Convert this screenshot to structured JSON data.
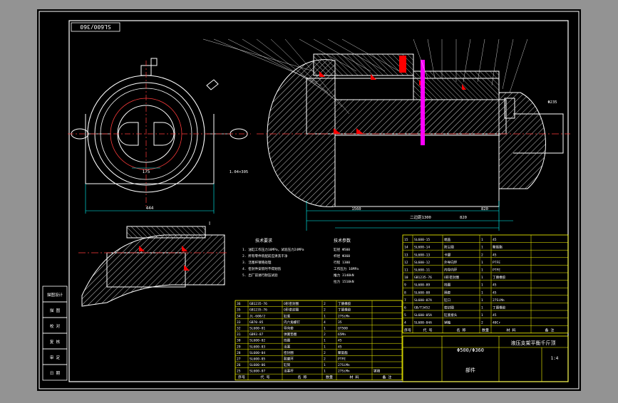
{
  "drawing": {
    "stamp": "SL600/360",
    "title_right": "液压支架平衡千斤顶",
    "title_label": "部件",
    "model_label": "Φ500/Φ360",
    "scale": "1:4",
    "view_callout": "Ⅰ"
  },
  "left_stamp_labels": [
    "描图设计",
    "描 图",
    "校 对",
    "复 核",
    "审 定",
    "日 期"
  ],
  "dimensions": {
    "dim_bottom_left": "444",
    "dim_center_a": "175",
    "dim_bottom_right_a": "1.04×305",
    "dim_long": "二边距1300",
    "dim_overall": "1560",
    "dim_rod": "820",
    "dim_end": "820",
    "dim_side": "Φ235"
  },
  "tech_requirements": {
    "title": "技术要求",
    "lines": [
      "1. 油缸工作压力16MPa，试验压力24MPa",
      "2. 所有零件装配前应清洗干净",
      "3. 活塞杆镀铬处理",
      "4. 密封件安装时不得划伤",
      "5. 出厂前进行耐压试验"
    ]
  },
  "tech_specs": {
    "title": "技术参数",
    "lines": [
      "缸径 Φ500",
      "杆径 Φ360",
      "行程 1300",
      "工作压力 16MPa",
      "推力 3140kN",
      "拉力 1510kN"
    ]
  },
  "parts_left_header": [
    "序号",
    "代 号",
    "名 称",
    "数量",
    "材 料",
    "备 注"
  ],
  "parts_left": [
    [
      "36",
      "GB1235-76",
      "O形密封圈",
      "2",
      "丁腈橡胶",
      ""
    ],
    [
      "35",
      "GB1235-76",
      "O形密封圈",
      "2",
      "丁腈橡胶",
      ""
    ],
    [
      "34",
      "JL-600/2",
      "缸底",
      "1",
      "27SiMn",
      ""
    ],
    [
      "33",
      "GB70-85",
      "内六角螺钉",
      "4",
      "35",
      ""
    ],
    [
      "32",
      "SL600-01",
      "导向套",
      "1",
      "QT500",
      ""
    ],
    [
      "31",
      "GB93-87",
      "弹簧垫圈",
      "2",
      "65Mn",
      ""
    ],
    [
      "30",
      "SL600-02",
      "挡圈",
      "1",
      "45",
      ""
    ],
    [
      "29",
      "SL600-03",
      "活塞",
      "1",
      "45",
      ""
    ],
    [
      "28",
      "SL600-04",
      "密封圈",
      "2",
      "聚氨酯",
      ""
    ],
    [
      "27",
      "SL600-05",
      "耐磨环",
      "2",
      "PTFE",
      ""
    ],
    [
      "26",
      "SL600-06",
      "缸筒",
      "1",
      "27SiMn",
      ""
    ],
    [
      "25",
      "SL600-07",
      "活塞杆",
      "1",
      "27SiMn",
      "镀铬"
    ]
  ],
  "parts_right": [
    [
      "15",
      "SL600-15",
      "端盖",
      "1",
      "45",
      ""
    ],
    [
      "14",
      "SL600-14",
      "防尘圈",
      "1",
      "聚氨酯",
      ""
    ],
    [
      "13",
      "SL600-13",
      "卡键",
      "2",
      "45",
      ""
    ],
    [
      "12",
      "SL600-12",
      "外导向环",
      "1",
      "PTFE",
      ""
    ],
    [
      "11",
      "SL600-11",
      "内导向环",
      "1",
      "PTFE",
      ""
    ],
    [
      "10",
      "GB1235-76",
      "O形密封圈",
      "1",
      "丁腈橡胶",
      ""
    ],
    [
      "9",
      "SL600-09",
      "挡圈",
      "1",
      "45",
      ""
    ],
    [
      "8",
      "SL600-08",
      "隔套",
      "1",
      "45",
      ""
    ],
    [
      "7",
      "SL600-07A",
      "缸口",
      "1",
      "27SiMn",
      ""
    ],
    [
      "6",
      "GB/T3452",
      "密封圈",
      "1",
      "丁腈橡胶",
      ""
    ],
    [
      "5",
      "SL600-05A",
      "缸底接头",
      "1",
      "45",
      ""
    ],
    [
      "4",
      "SL600-04A",
      "销轴",
      "2",
      "40Cr",
      ""
    ]
  ],
  "parts_right_header": [
    "序号",
    "代 号",
    "名 称",
    "数量",
    "材 料",
    "备 注"
  ],
  "colors": {
    "paper": "#000000",
    "border": "#ffffff",
    "outline": "#ffffff",
    "center": "#ff3b3b",
    "dim": "#00ffff",
    "hatch": "#d8d8d8",
    "table": "#ffff00",
    "text_white": "#ffffff",
    "accent_red": "#ff0000",
    "magenta": "#ff00ff"
  }
}
